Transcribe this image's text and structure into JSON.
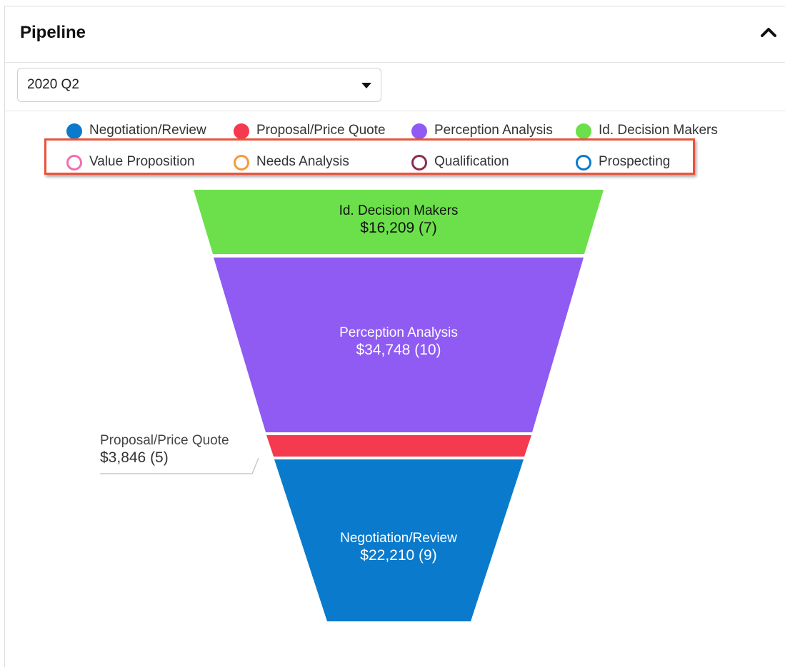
{
  "panel": {
    "title": "Pipeline",
    "filter_value": "2020 Q2"
  },
  "legend": [
    {
      "label": "Negotiation/Review",
      "color": "#0a7acc",
      "filled": true
    },
    {
      "label": "Proposal/Price Quote",
      "color": "#f5394f",
      "filled": true
    },
    {
      "label": "Perception Analysis",
      "color": "#8f5bf2",
      "filled": true
    },
    {
      "label": "Id. Decision Makers",
      "color": "#6be04b",
      "filled": true
    },
    {
      "label": "Value Proposition",
      "color": "#ef6fb0",
      "filled": false
    },
    {
      "label": "Needs Analysis",
      "color": "#f7993a",
      "filled": false
    },
    {
      "label": "Qualification",
      "color": "#8c2c55",
      "filled": false
    },
    {
      "label": "Prospecting",
      "color": "#0a7acc",
      "filled": false
    }
  ],
  "chart_data": {
    "type": "funnel",
    "series": [
      {
        "name": "Id. Decision Makers",
        "value": 16209,
        "value_label": "$16,209 (7)",
        "count": 7,
        "color": "#6be04b"
      },
      {
        "name": "Perception Analysis",
        "value": 34748,
        "value_label": "$34,748 (10)",
        "count": 10,
        "color": "#8f5bf2"
      },
      {
        "name": "Proposal/Price Quote",
        "value": 3846,
        "value_label": "$3,846 (5)",
        "count": 5,
        "color": "#f5394f"
      },
      {
        "name": "Negotiation/Review",
        "value": 22210,
        "value_label": "$22,210 (9)",
        "count": 9,
        "color": "#0a7acc"
      }
    ]
  }
}
